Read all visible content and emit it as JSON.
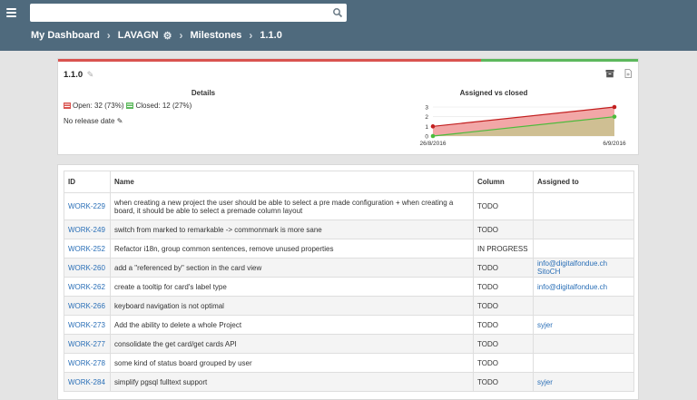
{
  "header": {
    "search": {
      "placeholder": "",
      "value": ""
    },
    "breadcrumb": [
      "My Dashboard",
      "LAVAGN",
      "Milestones",
      "1.1.0"
    ]
  },
  "milestone": {
    "title": "1.1.0",
    "progress_closed_fraction": 0.27,
    "details_heading": "Details",
    "open_text": "Open: 32 (73%)",
    "closed_text": "Closed: 12 (27%)",
    "release_date_text": "No release date",
    "colors": {
      "open": "#d9534f",
      "closed": "#5cb85c"
    }
  },
  "chart_data": {
    "type": "area",
    "title": "Assigned vs closed",
    "x": [
      "26/8/2016",
      "6/9/2016"
    ],
    "ylim": [
      0,
      3
    ],
    "yticks": [
      0,
      1,
      2,
      3
    ],
    "series": [
      {
        "name": "",
        "values": [
          1,
          3
        ],
        "color": "#c21f1f",
        "fill": "#f2a7a7"
      },
      {
        "name": "",
        "values": [
          0,
          2
        ],
        "color": "#4cbb3c",
        "fill": "#c9c38f"
      }
    ]
  },
  "table": {
    "columns": [
      "ID",
      "Name",
      "Column",
      "Assigned to"
    ],
    "rows": [
      {
        "id": "WORK-229",
        "name": "when creating a new project the user should be able to select a pre made configuration + when creating a board, it should be able to select a premade column layout",
        "column": "TODO",
        "assigned": ""
      },
      {
        "id": "WORK-249",
        "name": "switch from marked to remarkable -> commonmark is more sane",
        "column": "TODO",
        "assigned": ""
      },
      {
        "id": "WORK-252",
        "name": "Refactor i18n, group common sentences, remove unused properties",
        "column": "IN PROGRESS",
        "assigned": ""
      },
      {
        "id": "WORK-260",
        "name": "add a \"referenced by\" section in the card view",
        "column": "TODO",
        "assigned": "info@digitalfondue.ch SitoCH"
      },
      {
        "id": "WORK-262",
        "name": "create a tooltip for card's label type",
        "column": "TODO",
        "assigned": "info@digitalfondue.ch"
      },
      {
        "id": "WORK-266",
        "name": "keyboard navigation is not optimal",
        "column": "TODO",
        "assigned": ""
      },
      {
        "id": "WORK-273",
        "name": "Add the ability to delete a whole Project",
        "column": "TODO",
        "assigned": "syjer"
      },
      {
        "id": "WORK-277",
        "name": "consolidate the get card/get cards API",
        "column": "TODO",
        "assigned": ""
      },
      {
        "id": "WORK-278",
        "name": "some kind of status board grouped by user",
        "column": "TODO",
        "assigned": ""
      },
      {
        "id": "WORK-284",
        "name": "simplify pgsql fulltext support",
        "column": "TODO",
        "assigned": "syjer"
      }
    ]
  }
}
